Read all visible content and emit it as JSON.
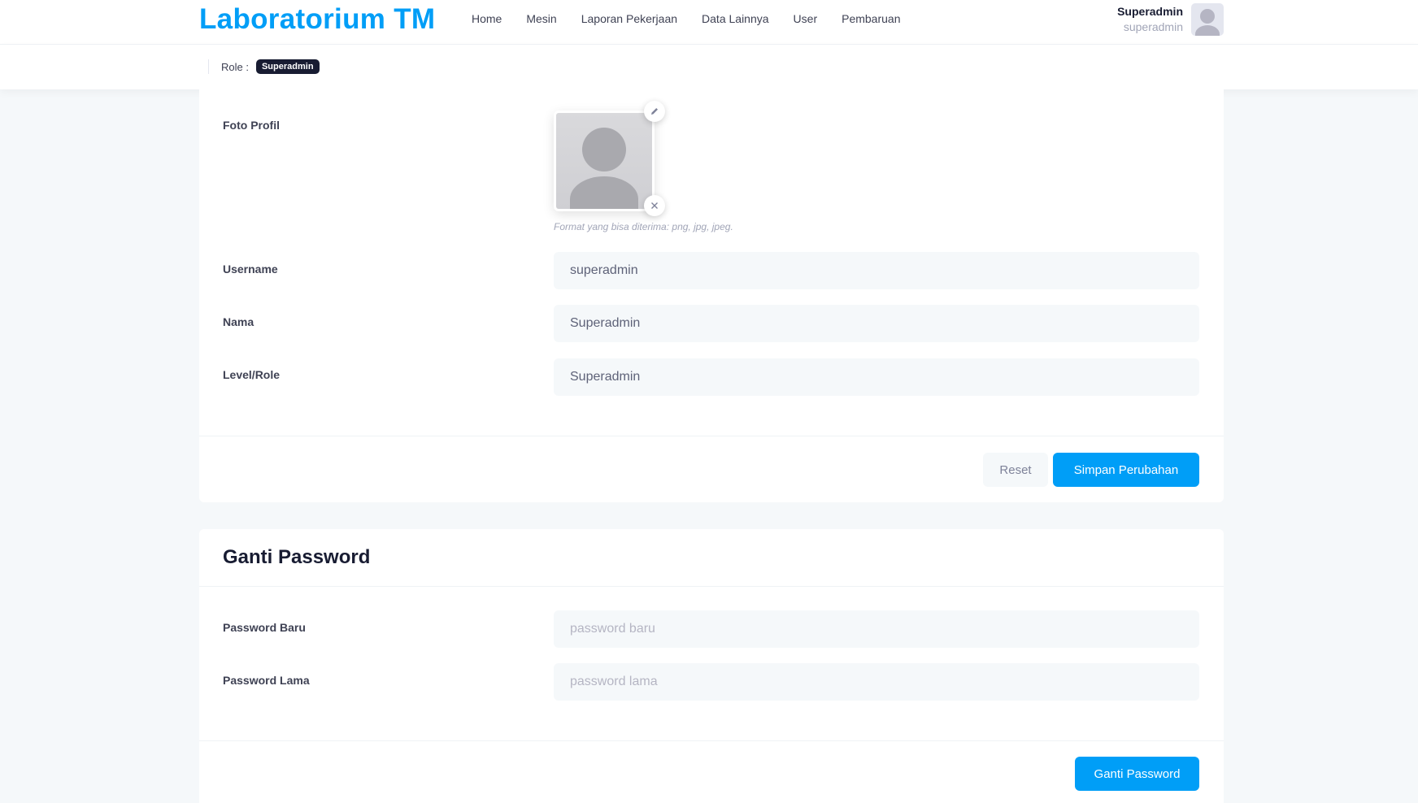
{
  "header": {
    "brand": "Laboratorium TM",
    "nav": [
      "Home",
      "Mesin",
      "Laporan Pekerjaan",
      "Data Lainnya",
      "User",
      "Pembaruan"
    ],
    "user_name": "Superadmin",
    "user_login": "superadmin"
  },
  "subheader": {
    "role_label": "Role :",
    "role_badge": "Superadmin"
  },
  "profile": {
    "photo_label": "Foto Profil",
    "photo_hint": "Format yang bisa diterima: png, jpg, jpeg.",
    "username_label": "Username",
    "username_value": "superadmin",
    "nama_label": "Nama",
    "nama_value": "Superadmin",
    "role_label": "Level/Role",
    "role_value": "Superadmin",
    "reset_button": "Reset",
    "save_button": "Simpan Perubahan"
  },
  "password": {
    "title": "Ganti Password",
    "new_label": "Password Baru",
    "new_placeholder": "password baru",
    "old_label": "Password Lama",
    "old_placeholder": "password lama",
    "submit_button": "Ganti Password"
  },
  "icons": {
    "edit": "pencil-icon",
    "remove": "close-icon"
  },
  "colors": {
    "primary": "#009ef7",
    "dark": "#181c32",
    "background": "#f5f8fa"
  }
}
